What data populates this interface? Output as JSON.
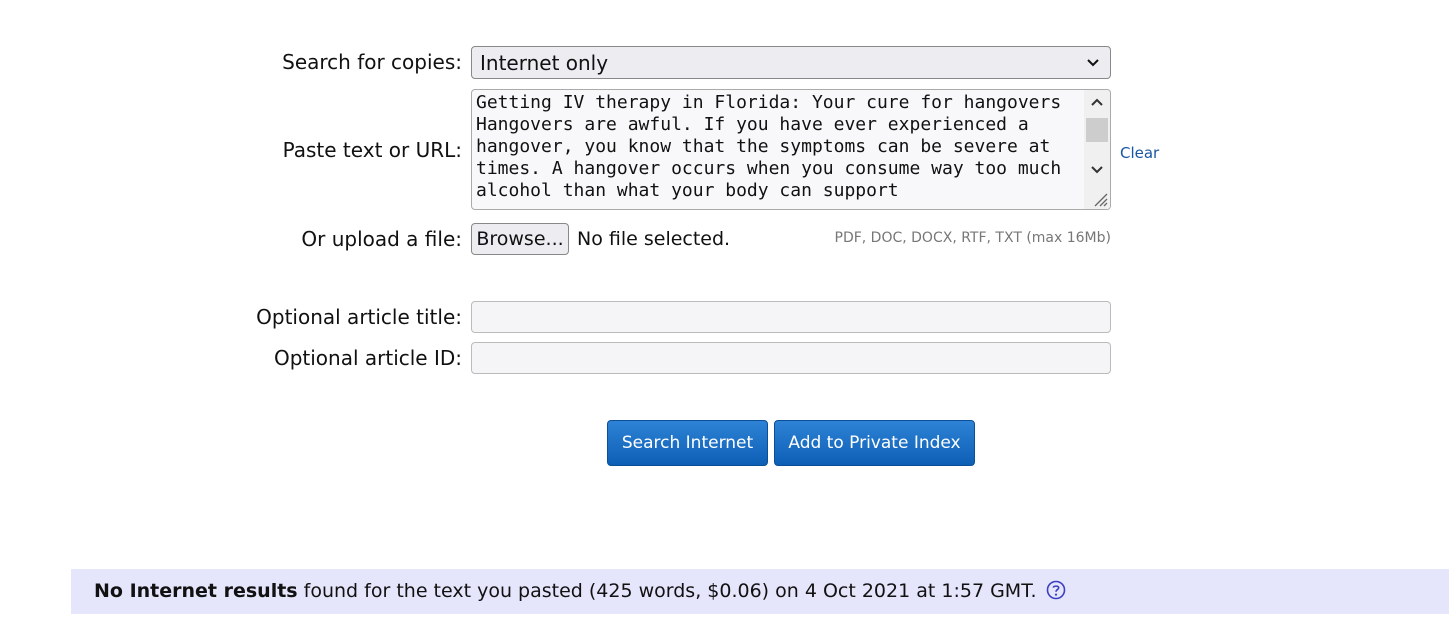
{
  "form": {
    "search_label": "Search for copies:",
    "search_value": "Internet only",
    "paste_label": "Paste text or URL:",
    "paste_value": "Getting IV therapy in Florida: Your cure for hangovers\nHangovers are awful. If you have ever experienced a hangover, you know that the symptoms can be severe at times. A hangover occurs when you consume way too much alcohol than what your body can support",
    "clear_label": "Clear",
    "upload_label": "Or upload a file:",
    "browse_label": "Browse...",
    "no_file_text": "No file selected.",
    "file_hint": "PDF, DOC, DOCX, RTF, TXT (max 16Mb)",
    "title_label": "Optional article title:",
    "title_value": "",
    "id_label": "Optional article ID:",
    "id_value": ""
  },
  "buttons": {
    "search": "Search Internet",
    "add": "Add to Private Index"
  },
  "result": {
    "bold": "No Internet results",
    "text": " found for the text you pasted (425 words, $0.06) on 4 Oct 2021 at 1:57 GMT."
  },
  "icons": {
    "select": "chevron-down-icon",
    "help": "help-circle-icon"
  },
  "colors": {
    "button": "#1469c4",
    "link": "#1a55a3",
    "result_bg": "#e5e5fb"
  }
}
